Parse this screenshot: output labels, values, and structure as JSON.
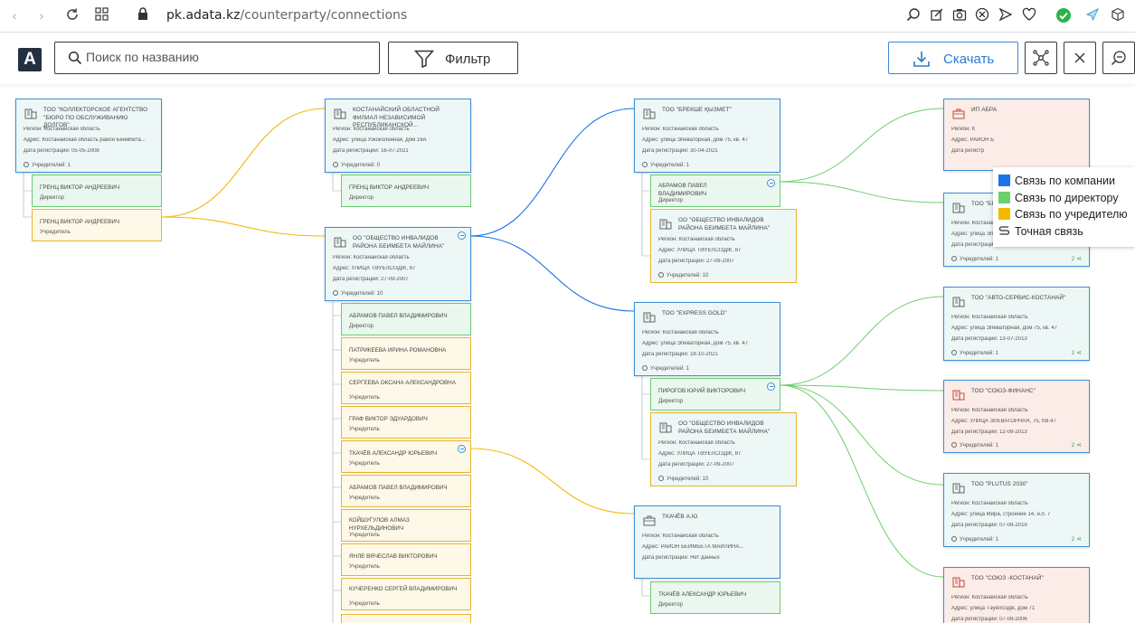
{
  "browser": {
    "url_host": "pk.adata.kz",
    "url_path": "/counterparty/connections"
  },
  "toolbar": {
    "logo": "A",
    "search_placeholder": "Поиск по названию",
    "filter_label": "Фильтр",
    "download_label": "Скачать"
  },
  "legend": {
    "company": "Связь по компании",
    "director": "Связь по директору",
    "founder": "Связь по учредителю",
    "exact": "Точная связь",
    "colors": {
      "company": "#1a73e8",
      "director": "#6cd06c",
      "founder": "#f5b800"
    }
  },
  "labels": {
    "region": "Регион: Костанайская область",
    "founders_prefix": "Учредителей: ",
    "reg_prefix": "Дата регистрации: ",
    "director": "Директор",
    "founder": "Учредитель"
  },
  "cards": {
    "c1": {
      "name": "ТОО \"КОЛЛЕКТОРСКОЕ АГЕНТСТВО \"БЮРО ПО ОБСЛУЖИВАНИЮ ДОЛГОВ\"",
      "region": "Регион: Костанайская область",
      "address": "Адрес: Костанайская область район Беимбета...",
      "date": "Дата регистрации: 05-05-2008",
      "founders": "Учредителей: 1"
    },
    "p1": {
      "name": "ГРЕНЦ ВИКТОР АНДРЕЕВИЧ",
      "role": "Директор"
    },
    "p2": {
      "name": "ГРЕНЦ ВИКТОР АНДРЕЕВИЧ",
      "role": "Учредитель"
    },
    "c2": {
      "name": "КОСТАНАЙСКИЙ ОБЛАСТНОЙ ФИЛИАЛ НЕЗАВИСИМОЙ РЕСПУБЛИКАНСКОЙ...",
      "region": "Регион: Костанайская область",
      "address": "Адрес: улица Узкоколейная, дом 16А",
      "date": "Дата регистрации: 16-07-2021",
      "founders": "Учредителей: 0"
    },
    "p3": {
      "name": "ГРЕНЦ ВИКТОР АНДРЕЕВИЧ",
      "role": "Директор"
    },
    "c3": {
      "name": "ОО \"ОБЩЕСТВО ИНВАЛИДОВ РАЙОНА БЕИМБЕТА МАЙЛИНА\"",
      "region": "Регион: Костанайская область",
      "address": "Адрес: УЛИЦА ТӘУЕЛСІЗДІК, 87",
      "date": "Дата регистрации: 27-09-2007",
      "founders": "Учредителей: 10"
    },
    "list": [
      {
        "name": "АБРАМОВ ПАВЕЛ ВЛАДИМИРОВИЧ",
        "role": "Директор"
      },
      {
        "name": "ПАТРИКЕЕВА ИРИНА РОМАНОВНА",
        "role": "Учредитель"
      },
      {
        "name": "СЕРГЕЕВА ОКСАНА АЛЕКСАНДРОВНА",
        "role": "Учредитель"
      },
      {
        "name": "ГРАФ ВИКТОР ЭДУАРДОВИЧ",
        "role": "Учредитель"
      },
      {
        "name": "ТКАЧЁВ АЛЕКСАНДР ЮРЬЕВИЧ",
        "role": "Учредитель"
      },
      {
        "name": "АБРАМОВ ПАВЕЛ ВЛАДИМИРОВИЧ",
        "role": "Учредитель"
      },
      {
        "name": "КОЙШУГУЛОВ АЛМАЗ НУРХЕЛЬДИНОВИЧ",
        "role": "Учредитель"
      },
      {
        "name": "ЯНЛЕ ВЯЧЕСЛАВ ВИКТОРОВИЧ",
        "role": "Учредитель"
      },
      {
        "name": "КУЧЕРЕНКО СЕРГЕЙ ВЛАДИМИРОВИЧ",
        "role": "Учредитель"
      }
    ],
    "c4": {
      "name": "ТОО \"БРЕКШЕ ҚЫЗМЕТ\"",
      "region": "Регион: Костанайская область",
      "address": "Адрес: улица Элеваторная, дом 75, кв. 47",
      "date": "Дата регистрации: 30-04-2021",
      "founders": "Учредителей: 1"
    },
    "p4": {
      "name": "АБРАМОВ ПАВЕЛ ВЛАДИМИРОВИЧ",
      "role": "Директор"
    },
    "c5": {
      "name": "ОО \"ОБЩЕСТВО ИНВАЛИДОВ РАЙОНА БЕИМБЕТА МАЙЛИНА\"",
      "region": "Регион: Костанайская область",
      "address": "Адрес: УЛИЦА ТӘУЕЛСІЗДІК, 87",
      "date": "Дата регистрации: 27-09-2007",
      "founders": "Учредителей: 10"
    },
    "c6": {
      "name": "ТОО \"EXPRESS GOLD\"",
      "region": "Регион: Костанайская область",
      "address": "Адрес: улица Элеваторная, дом 75, кв. 47",
      "date": "Дата регистрации: 18-10-2021",
      "founders": "Учредителей: 1"
    },
    "p5": {
      "name": "ПИРОГОВ ЮРИЙ ВИКТОРОВИЧ",
      "role": "Директор"
    },
    "c7": {
      "name": "ОО \"ОБЩЕСТВО ИНВАЛИДОВ РАЙОНА БЕИМБЕТА МАЙЛИНА\"",
      "region": "Регион: Костанайская область",
      "address": "Адрес: УЛИЦА ТӘУЕЛСІЗДІК, 87",
      "date": "Дата регистрации: 27-09-2007",
      "founders": "Учредителей: 10"
    },
    "c8": {
      "name": "ТКАЧЁВ А.Ю",
      "region": "Регион: Костанайская область",
      "address": "Адрес: РАЙОН БЕИМБЕТА МАЙЛИНА...",
      "date": "Дата регистрации: Нет данных"
    },
    "p6": {
      "name": "ТКАЧЁВ АЛЕКСАНДР ЮРЬЕВИЧ",
      "role": "Директор"
    },
    "r1": {
      "name": "ИП АБРА",
      "region": "Регион: К",
      "address": "Адрес: РАЙОН Б",
      "date": "Дата регистр"
    },
    "r2": {
      "name": "ТОО \"БРЕКШЕ ҚЫЗМЕТ\"",
      "region": "Регион: Костанайская область",
      "address": "Адрес: улица Элеваторная, дом 75, кв. 47",
      "date": "Дата регистрации: 30-04-2021",
      "founders": "Учредителей: 1",
      "count": "2"
    },
    "r3": {
      "name": "ТОО \"АВТО-СЕРВИС-КОСТАНАЙ\"",
      "region": "Регион: Костанайская область",
      "address": "Адрес: улица Элеваторная, дом 75, кв. 47",
      "date": "Дата регистрации: 13-07-2013",
      "founders": "Учредителей: 1",
      "count": "2"
    },
    "r4": {
      "name": "ТОО \"СОЮЗ-ФИНАНС\"",
      "region": "Регион: Костанайская область",
      "address": "Адрес: УЛИЦА ЭЛЕВАТОРНАЯ, 75, КВ.47",
      "date": "Дата регистрации: 12-08-2013",
      "founders": "Учредителей: 1",
      "count": "2"
    },
    "r5": {
      "name": "ТОО \"PLUTUS 2030\"",
      "region": "Регион: Костанайская область",
      "address": "Адрес: улица Мира, строение 14, н.п. 7",
      "date": "Дата регистрации: 07-08-2019",
      "founders": "Учредителей: 1",
      "count": "2"
    },
    "r6": {
      "name": "ТОО \"СОЮЗ -КОСТАНАЙ\"",
      "region": "Регион: Костанайская область",
      "address": "Адрес: улица Тәуелсіздік, дом 71",
      "date": "Дата регистрации: 07-08-2006"
    }
  }
}
